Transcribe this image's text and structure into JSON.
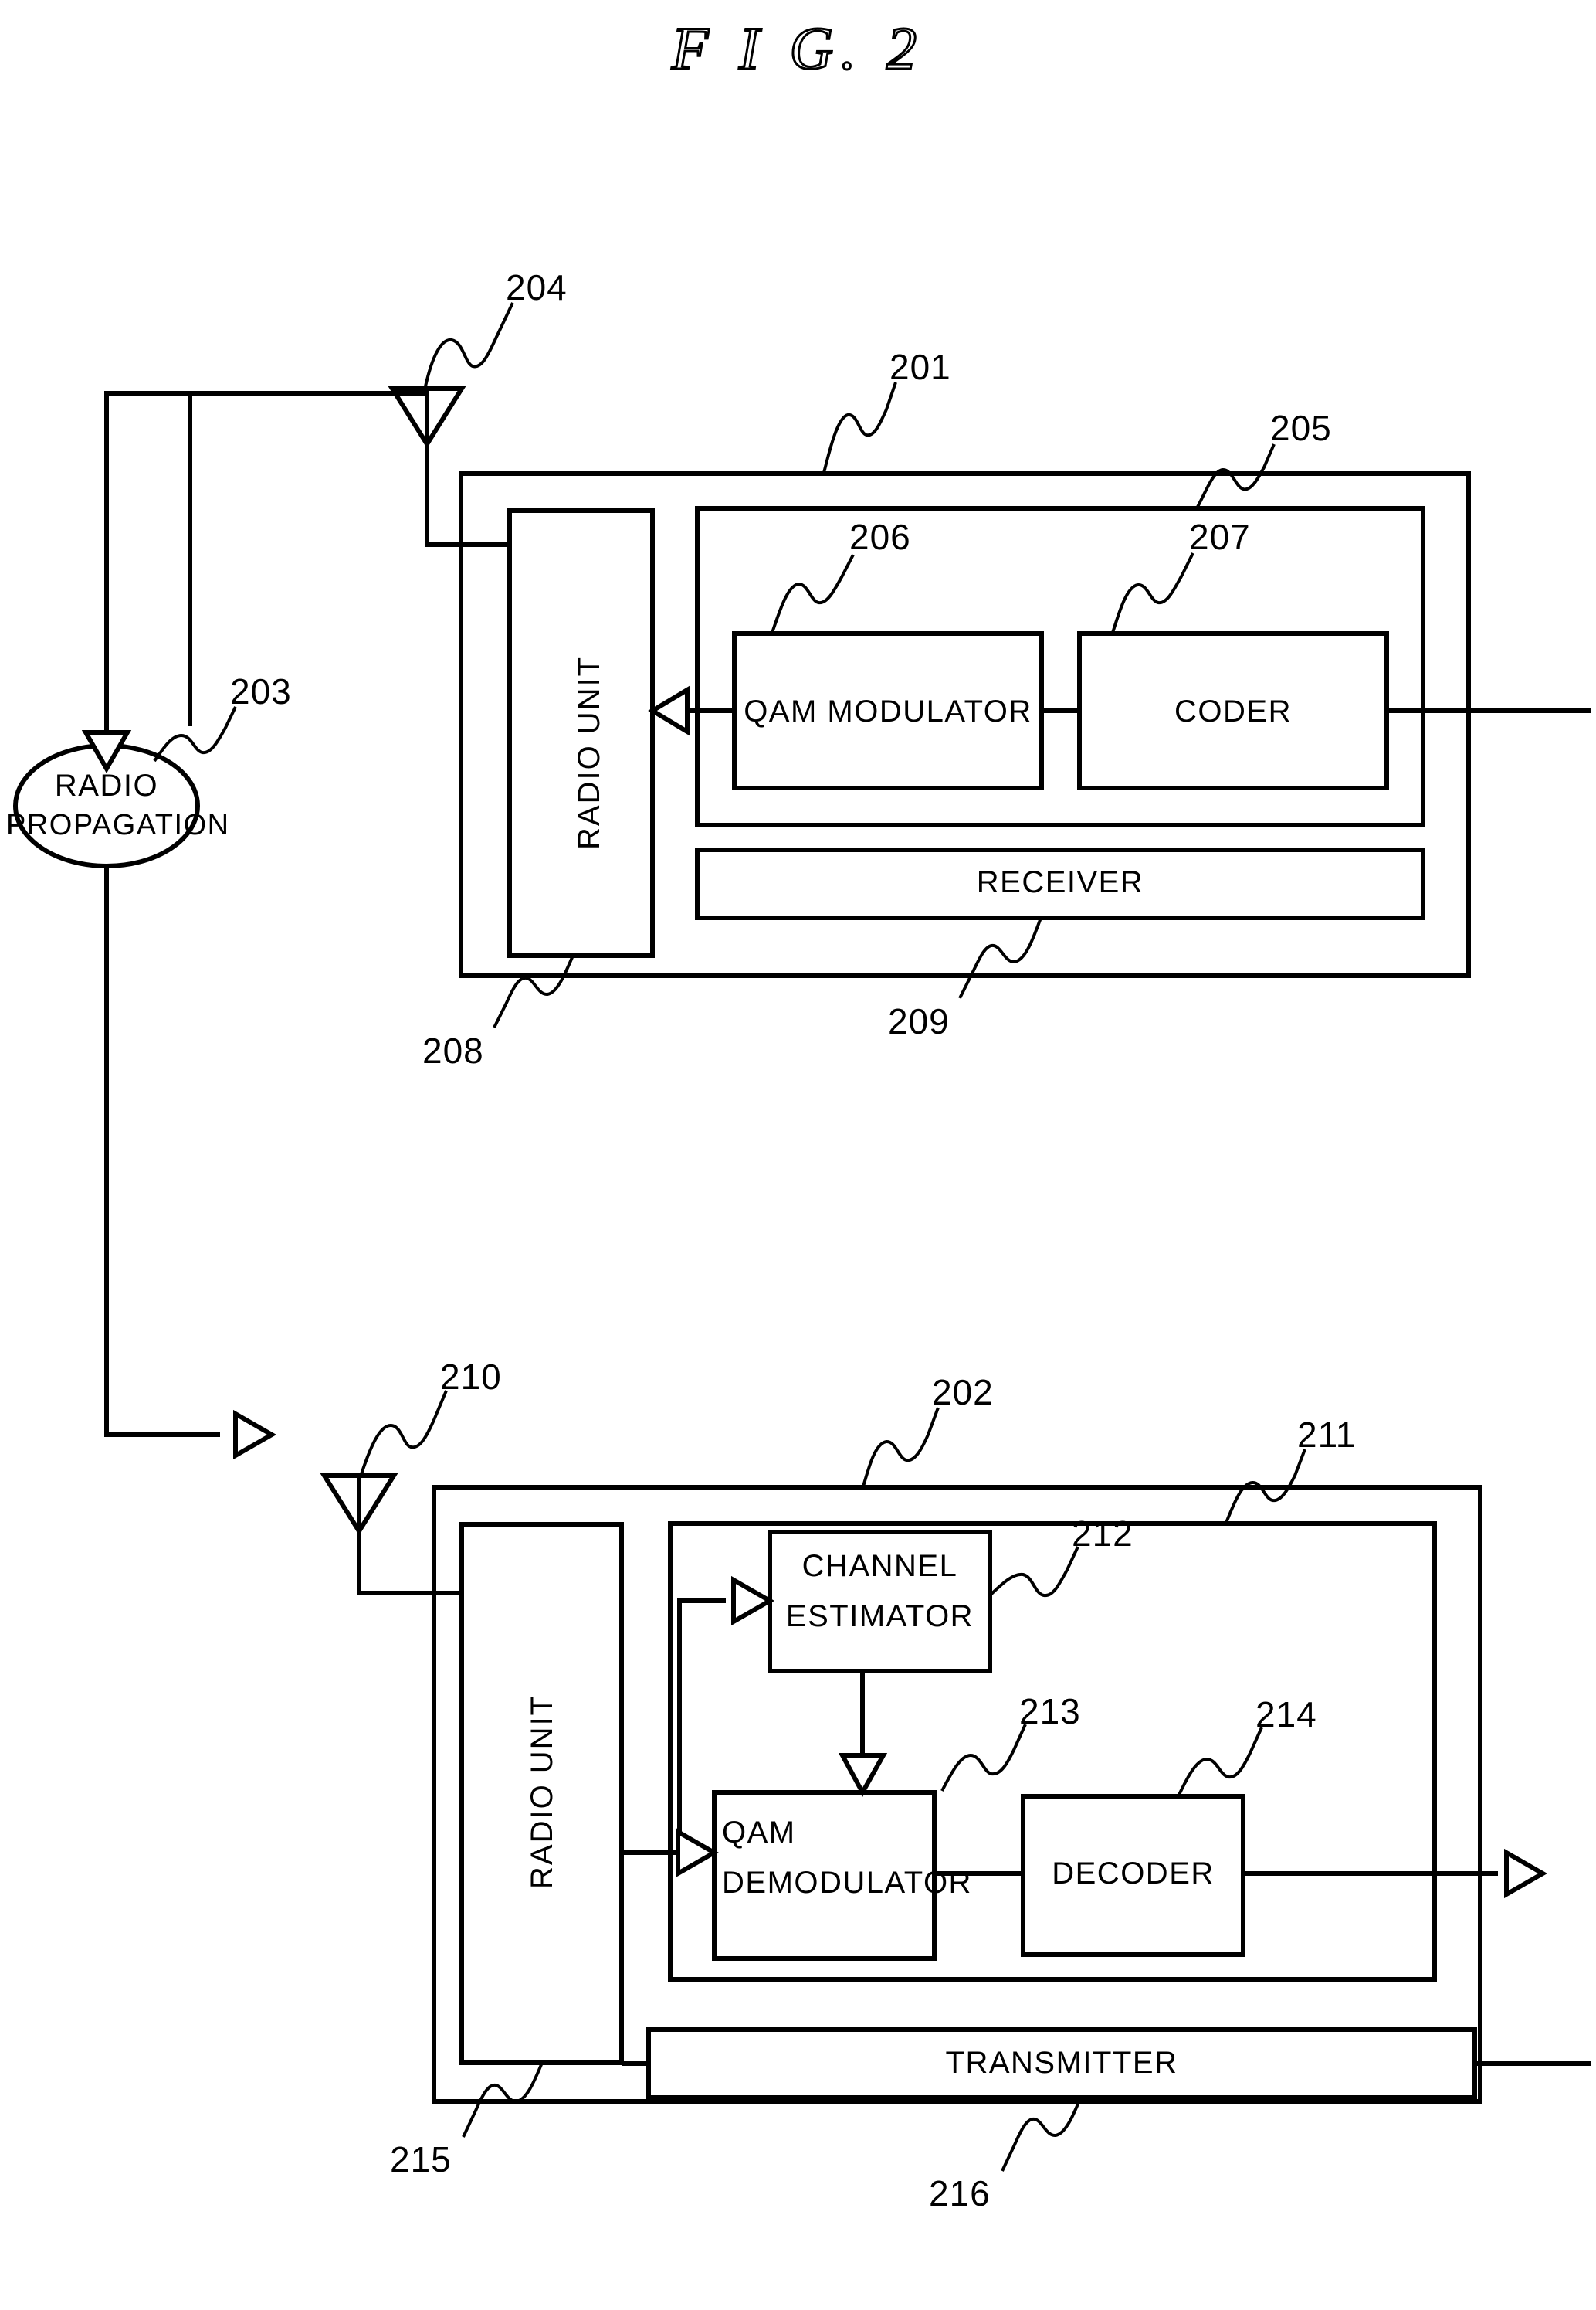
{
  "figure": {
    "title": "F I G. 2"
  },
  "nodes": {
    "radio_propagation": "RADIO\nPROPAGATION",
    "radio_propagation_line1": "RADIO",
    "radio_propagation_line2": "PROPAGATION",
    "radio_unit_tx": "RADIO UNIT",
    "radio_unit_rx": "RADIO UNIT",
    "qam_modulator": "QAM MODULATOR",
    "coder": "CODER",
    "receiver": "RECEIVER",
    "channel_estimator_line1": "CHANNEL",
    "channel_estimator_line2": "ESTIMATOR",
    "qam_demodulator_line1": "QAM",
    "qam_demodulator_line2": "DEMODULATOR",
    "decoder": "DECODER",
    "transmitter": "TRANSMITTER"
  },
  "reference_numerals": {
    "n201": "201",
    "n202": "202",
    "n203": "203",
    "n204": "204",
    "n205": "205",
    "n206": "206",
    "n207": "207",
    "n208": "208",
    "n209": "209",
    "n210": "210",
    "n211": "211",
    "n212": "212",
    "n213": "213",
    "n214": "214",
    "n215": "215",
    "n216": "216"
  },
  "colors": {
    "stroke": "#000000",
    "background": "#ffffff"
  }
}
